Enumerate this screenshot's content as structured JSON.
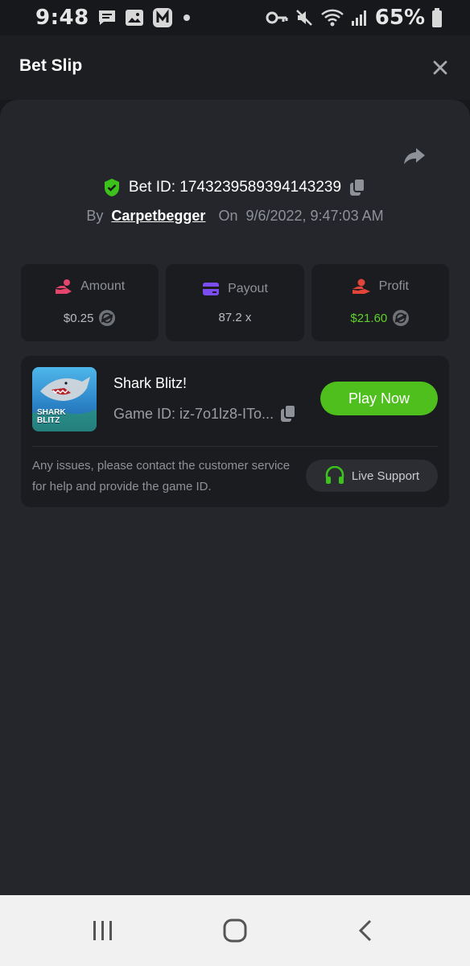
{
  "status_bar": {
    "time": "9:48",
    "battery_percent": "65%",
    "left_icons": [
      "message-icon",
      "image-icon",
      "app-n-icon",
      "dot-icon"
    ],
    "right_icons": [
      "key-icon",
      "mute-icon",
      "wifi-icon",
      "signal-icon",
      "battery-icon"
    ]
  },
  "header": {
    "title": "Bet Slip",
    "close_icon": "close-icon"
  },
  "bet": {
    "id_text": "Bet ID: 1743239589394143239",
    "by_label": "By",
    "username": "Carpetbegger",
    "on_label": "On",
    "datetime": "9/6/2022, 9:47:03 AM"
  },
  "stats": [
    {
      "label": "Amount",
      "value": "$0.25",
      "icon": "hand-coin-icon",
      "icon_color": "#e5446d",
      "value_color": "#b8bbc0",
      "currency_icon": "stellar-coin-icon"
    },
    {
      "label": "Payout",
      "value": "87.2 x",
      "icon": "card-icon",
      "icon_color": "#7b4df0",
      "value_color": "#b8bbc0"
    },
    {
      "label": "Profit",
      "value": "$21.60",
      "icon": "hand-money-icon",
      "icon_color": "#e2443a",
      "value_color": "#5fd128",
      "currency_icon": "stellar-coin-icon"
    }
  ],
  "game": {
    "name": "Shark Blitz!",
    "game_id": "Game ID: iz-7o1lz8-ITo...",
    "thumb_title_line1": "SHARK",
    "thumb_title_line2": "BLITZ",
    "play_label": "Play Now",
    "notice": "Any issues, please contact the customer service for help and provide the game ID.",
    "support_label": "Live Support"
  },
  "colors": {
    "accent_green": "#4fbf1e",
    "profit_green": "#5fd128",
    "panel_bg": "#24262b",
    "card_bg": "#1b1c20"
  },
  "nav_bar": {
    "buttons": [
      "recent-apps-icon",
      "home-icon",
      "back-icon"
    ]
  }
}
